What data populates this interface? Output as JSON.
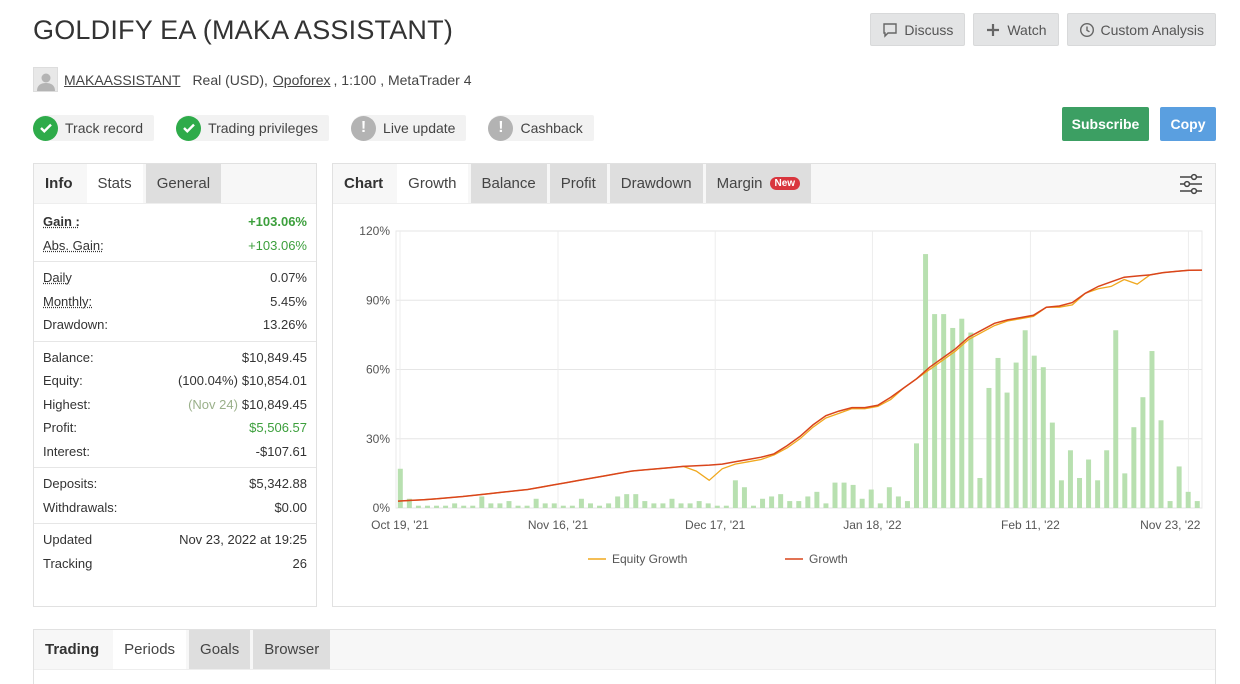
{
  "header": {
    "title": "GOLDIFY EA (MAKA ASSISTANT)",
    "actions": [
      {
        "label": "Discuss",
        "icon": "comment-icon"
      },
      {
        "label": "Watch",
        "icon": "plus-icon"
      },
      {
        "label": "Custom Analysis",
        "icon": "clock-icon"
      }
    ]
  },
  "account": {
    "user": "MAKAASSISTANT",
    "type": "Real (USD),",
    "broker": "Opoforex",
    "leverage": ", 1:100 , MetaTrader 4"
  },
  "badges": [
    {
      "label": "Track record",
      "status": "ok"
    },
    {
      "label": "Trading privileges",
      "status": "ok"
    },
    {
      "label": "Live update",
      "status": "warn"
    },
    {
      "label": "Cashback",
      "status": "warn"
    }
  ],
  "buttons": {
    "subscribe": "Subscribe",
    "copy": "Copy"
  },
  "info_tabs": {
    "label": "Info",
    "tabs": [
      "Stats",
      "General"
    ]
  },
  "stats": {
    "gain": {
      "k": "Gain :",
      "v": "+103.06%"
    },
    "abs_gain": {
      "k": "Abs. Gain:",
      "v": "+103.06%"
    },
    "daily": {
      "k": "Daily",
      "v": "0.07%"
    },
    "monthly": {
      "k": "Monthly:",
      "v": "5.45%"
    },
    "drawdown": {
      "k": "Drawdown:",
      "v": "13.26%"
    },
    "balance": {
      "k": "Balance:",
      "v": "$10,849.45"
    },
    "equity": {
      "k": "Equity:",
      "pre": "(100.04%)",
      "v": "$10,854.01"
    },
    "highest": {
      "k": "Highest:",
      "pre": "(Nov 24)",
      "v": "$10,849.45"
    },
    "profit": {
      "k": "Profit:",
      "v": "$5,506.57"
    },
    "interest": {
      "k": "Interest:",
      "v": "-$107.61"
    },
    "deposits": {
      "k": "Deposits:",
      "v": "$5,342.88"
    },
    "withdrawals": {
      "k": "Withdrawals:",
      "v": "$0.00"
    },
    "updated": {
      "k": "Updated",
      "v": "Nov 23, 2022 at 19:25"
    },
    "tracking": {
      "k": "Tracking",
      "v": "26"
    }
  },
  "chart_tabs": {
    "label": "Chart",
    "tabs": [
      "Growth",
      "Balance",
      "Profit",
      "Drawdown",
      "Margin"
    ],
    "new_badge": "New"
  },
  "bottom_tabs": {
    "label": "Trading",
    "tabs": [
      "Periods",
      "Goals",
      "Browser"
    ]
  },
  "colors": {
    "growth": "#d9451c",
    "equity": "#f0a81e",
    "bars": "#b8e0b0",
    "green_button": "#3c9f63",
    "blue_button": "#5a9fe0"
  },
  "chart_data": {
    "type": "line",
    "x_tick_labels": [
      "Oct 19, '21",
      "Nov 16, '21",
      "Dec 17, '21",
      "Jan 18, '22",
      "Feb 11, '22",
      "Nov 23, '22"
    ],
    "y_tick_labels": [
      "0%",
      "30%",
      "60%",
      "90%",
      "120%"
    ],
    "ylim": [
      0,
      120
    ],
    "grid": true,
    "legend": "bottom",
    "series": [
      {
        "name": "Equity Growth",
        "values": [
          3,
          3.3,
          3.6,
          4,
          4.5,
          5,
          5.6,
          6.2,
          6.8,
          7.4,
          8,
          9,
          10,
          11,
          12,
          13,
          14,
          15,
          16,
          16.5,
          17,
          17.5,
          18,
          16,
          12,
          17,
          19,
          20,
          21,
          23,
          26,
          30,
          35,
          39,
          41,
          43,
          43,
          44,
          47,
          52,
          56,
          60,
          64,
          68,
          73,
          76,
          79,
          81,
          82,
          83,
          87,
          87,
          88,
          93,
          95,
          96,
          99,
          97,
          101,
          102,
          102.5,
          103,
          103.06
        ]
      },
      {
        "name": "Growth",
        "values": [
          3,
          3.3,
          3.6,
          4,
          4.5,
          5,
          5.6,
          6.2,
          6.8,
          7.4,
          8,
          9,
          10,
          11,
          12,
          13,
          14,
          15,
          16,
          16.5,
          17,
          17.5,
          18,
          18.3,
          18.6,
          19,
          20,
          21,
          22,
          23.5,
          27,
          31,
          36,
          40,
          42,
          43.5,
          43.5,
          44.5,
          48,
          52,
          56,
          61,
          65,
          69,
          74,
          77,
          80,
          81.5,
          82.5,
          83.5,
          87,
          87.5,
          89,
          93,
          96,
          98,
          100,
          100.5,
          101,
          102,
          102.5,
          103,
          103.06
        ]
      }
    ],
    "bars": {
      "name": "",
      "values": [
        17,
        4,
        1,
        1,
        1,
        1,
        2,
        1,
        1,
        5,
        2,
        2,
        3,
        1,
        1,
        4,
        2,
        2,
        1,
        1,
        4,
        2,
        1,
        2,
        5,
        6,
        6,
        3,
        2,
        2,
        4,
        2,
        2,
        3,
        2,
        1,
        1,
        12,
        9,
        1,
        4,
        5,
        6,
        3,
        3,
        5,
        7,
        2,
        11,
        11,
        10,
        4,
        8,
        2,
        9,
        5,
        3,
        28,
        110,
        84,
        84,
        78,
        82,
        76,
        13,
        52,
        65,
        50,
        63,
        77,
        66,
        61,
        37,
        12,
        25,
        13,
        21,
        12,
        25,
        77,
        15,
        35,
        48,
        68,
        38,
        3,
        18,
        7,
        3
      ]
    }
  }
}
